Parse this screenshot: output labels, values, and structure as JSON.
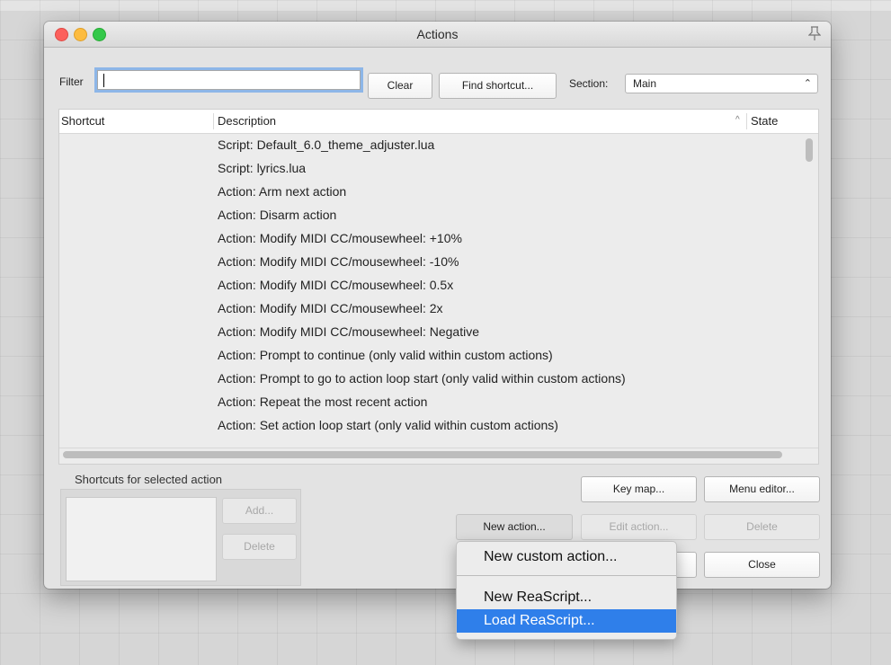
{
  "window": {
    "title": "Actions"
  },
  "toolbar": {
    "filter_label": "Filter",
    "filter_value": "",
    "clear_label": "Clear",
    "find_shortcut_label": "Find shortcut...",
    "section_label": "Section:",
    "section_value": "Main"
  },
  "list": {
    "columns": [
      "Shortcut",
      "Description",
      "State"
    ],
    "sort_indicator": "^",
    "rows": [
      "Script: Default_6.0_theme_adjuster.lua",
      "Script: lyrics.lua",
      "Action: Arm next action",
      "Action: Disarm action",
      "Action: Modify MIDI CC/mousewheel: +10%",
      "Action: Modify MIDI CC/mousewheel: -10%",
      "Action: Modify MIDI CC/mousewheel: 0.5x",
      "Action: Modify MIDI CC/mousewheel: 2x",
      "Action: Modify MIDI CC/mousewheel: Negative",
      "Action: Prompt to continue (only valid within custom actions)",
      "Action: Prompt to go to action loop start (only valid within custom actions)",
      "Action: Repeat the most recent action",
      "Action: Set action loop start (only valid within custom actions)"
    ]
  },
  "shortcuts_panel": {
    "title": "Shortcuts for selected action",
    "add_label": "Add...",
    "delete_label": "Delete"
  },
  "buttons": {
    "key_map": "Key map...",
    "menu_editor": "Menu editor...",
    "new_action": "New action...",
    "edit_action": "Edit action...",
    "delete": "Delete",
    "close": "Close"
  },
  "dropdown": {
    "items": [
      "New custom action...",
      "New ReaScript...",
      "Load ReaScript..."
    ],
    "highlighted_index": 2
  },
  "colors": {
    "accent": "#2f7fea",
    "focus_ring": "#8db6e8"
  },
  "icons": [
    "pin-icon",
    "sort-ascending-icon",
    "select-arrows-icon"
  ]
}
